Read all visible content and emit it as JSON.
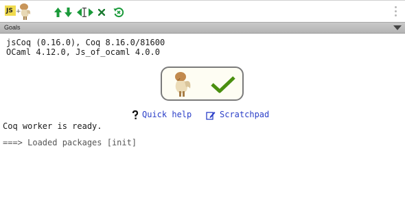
{
  "toolbar": {
    "js_badge": "JS",
    "plus": "+",
    "buttons": [
      {
        "name": "step-forward-button",
        "icon": "arrow-up-icon"
      },
      {
        "name": "step-backward-button",
        "icon": "arrow-down-icon"
      },
      {
        "name": "goto-cursor-button",
        "icon": "goto-cursor-icon"
      },
      {
        "name": "interrupt-button",
        "icon": "close-icon"
      },
      {
        "name": "reset-button",
        "icon": "reset-icon"
      }
    ],
    "accent_color": "#1a9a3a"
  },
  "goals": {
    "title": "Goals"
  },
  "content": {
    "version_line1": "jsCoq (0.16.0), Coq 8.16.0/81600",
    "version_line2": "OCaml 4.12.0, Js_of_ocaml 4.0.0",
    "quick_help": "Quick help",
    "scratchpad": "Scratchpad",
    "ready": "Coq worker is ready.",
    "loaded": "===> Loaded packages [init]",
    "check_color": "#4a8f0f",
    "link_color": "#2a3ec8"
  }
}
